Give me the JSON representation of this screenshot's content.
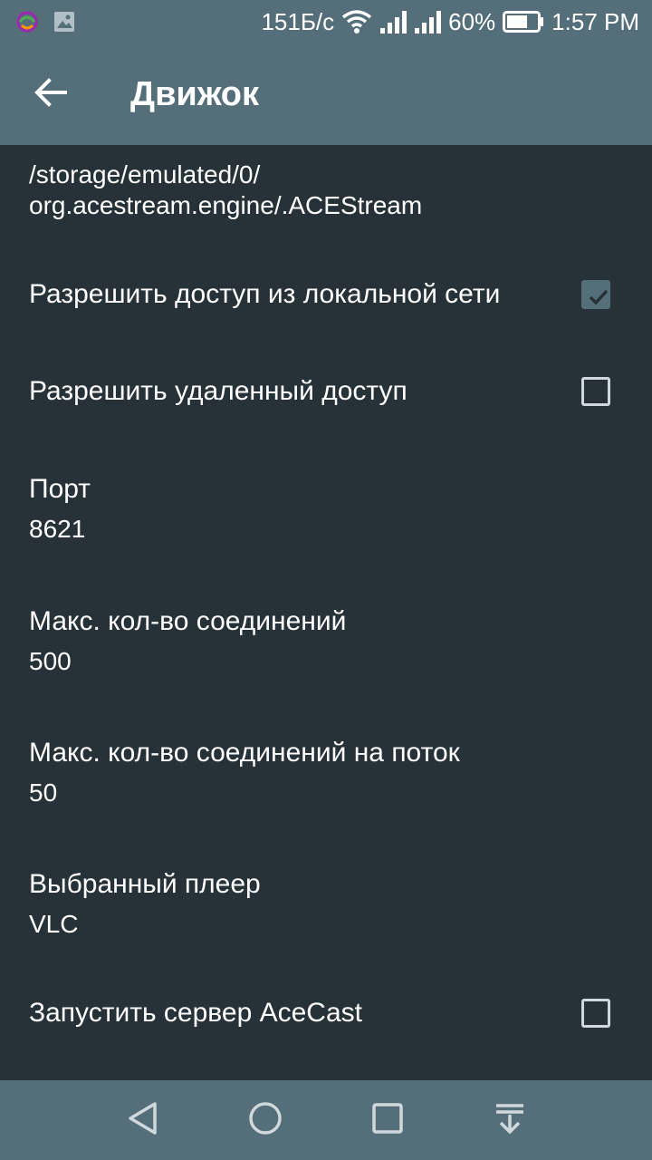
{
  "status_bar": {
    "speed": "151Б/с",
    "battery": "60%",
    "time": "1:57 PM"
  },
  "toolbar": {
    "title": "Движок"
  },
  "preferences": {
    "cache_path": {
      "summary_line1": "/storage/emulated/0/",
      "summary_line2": "org.acestream.engine/.ACEStream"
    },
    "local_access": {
      "title": "Разрешить доступ из локальной сети",
      "checked": true
    },
    "remote_access": {
      "title": "Разрешить удаленный доступ",
      "checked": false
    },
    "port": {
      "title": "Порт",
      "value": "8621"
    },
    "max_connections": {
      "title": "Макс. кол-во соединений",
      "value": "500"
    },
    "max_connections_per_stream": {
      "title": "Макс. кол-во соединений на поток",
      "value": "50"
    },
    "selected_player": {
      "title": "Выбранный плеер",
      "value": "VLC"
    },
    "acecast_server": {
      "title": "Запустить сервер AceCast",
      "checked": false
    }
  },
  "colors": {
    "primary": "#546e7a",
    "background": "#263238",
    "text": "#ffffff"
  },
  "icons": {
    "back": "arrow-back-icon",
    "nav_back": "triangle-back-icon",
    "nav_home": "circle-home-icon",
    "nav_recents": "square-recents-icon",
    "nav_notifications": "pull-down-icon"
  }
}
